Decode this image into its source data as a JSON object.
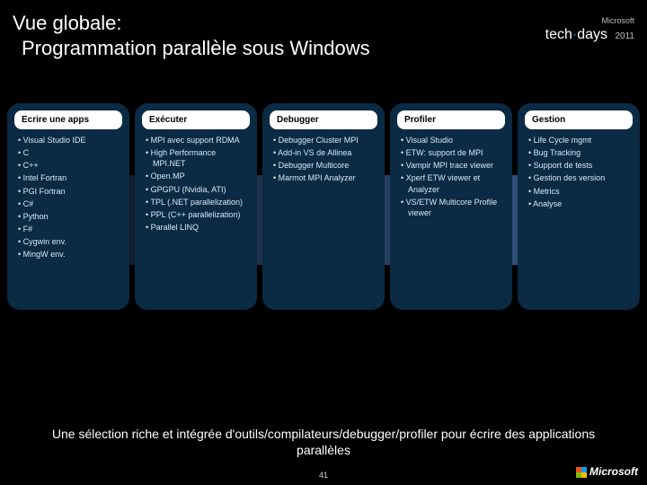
{
  "header": {
    "title_line1": "Vue globale:",
    "title_line2": "Programmation parallèle sous Windows",
    "ms": "Microsoft",
    "brand_pre": "tech",
    "brand_post": "days",
    "year": "2011"
  },
  "columns": [
    {
      "title": "Ecrire une apps",
      "items": [
        "Visual Studio IDE",
        "C",
        "C++",
        "Intel Fortran",
        "PGI Fortran",
        "C#",
        "Python",
        "F#",
        "Cygwin env.",
        "MingW env."
      ]
    },
    {
      "title": "Exécuter",
      "items": [
        "MPI avec support RDMA",
        "High Performance MPI.NET",
        "Open.MP",
        "GPGPU (Nvidia, ATI)",
        "TPL (.NET parallelization)",
        "PPL (C++ parallelization)",
        "Parallel LINQ"
      ]
    },
    {
      "title": "Debugger",
      "items": [
        "Debugger Cluster MPI",
        "Add-in VS de Allinea",
        "Debugger Multicore",
        "Marmot MPI Analyzer"
      ]
    },
    {
      "title": "Profiler",
      "items": [
        "Visual Studio",
        "ETW: support de MPI",
        "Vampir MPI trace viewer",
        "Xperf ETW viewer et Analyzer",
        "VS/ETW Multicore Profile viewer"
      ]
    },
    {
      "title": "Gestion",
      "items": [
        "Life Cycle mgmt",
        "Bug Tracking",
        "Support de tests",
        "Gestion des version",
        "Metrics",
        "Analyse"
      ]
    }
  ],
  "bottom": "Une sélection riche et intégrée d'outils/compilateurs/debugger/profiler pour écrire des applications parallèles",
  "page": "41",
  "footer_brand": "Microsoft"
}
